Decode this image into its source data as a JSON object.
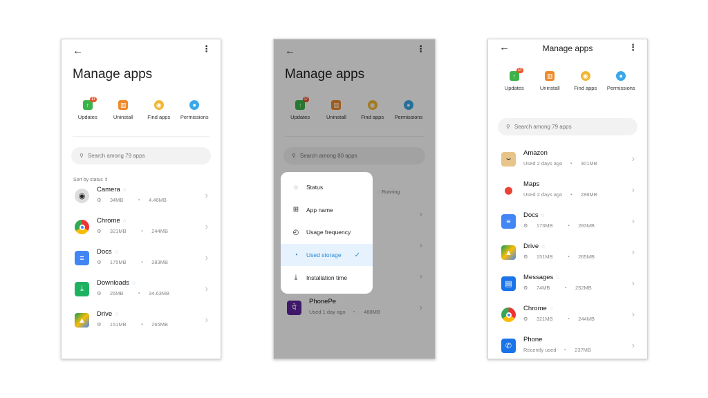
{
  "colors": {
    "accent": "#2a8ad8",
    "running": "#4a9ee0",
    "updates": "#3bb34a",
    "uninstall": "#ee8a2c",
    "find": "#f2b632",
    "permissions": "#3aa8e8"
  },
  "panels": [
    {
      "title": "Manage apps",
      "search_placeholder": "Search among 79 apps",
      "sort_label": "Sort by status ⇕",
      "tools": [
        {
          "label": "Updates",
          "icon": "updates-icon",
          "badge": "17"
        },
        {
          "label": "Uninstall",
          "icon": "trash-icon"
        },
        {
          "label": "Find apps",
          "icon": "find-apps-icon"
        },
        {
          "label": "Permissions",
          "icon": "permissions-icon"
        }
      ],
      "apps": [
        {
          "name": "Camera",
          "running": true,
          "m1": "34MB",
          "m2": "4.46MB",
          "icon": "camera-icon"
        },
        {
          "name": "Chrome",
          "running": true,
          "m1": "321MB",
          "m2": "244MB",
          "icon": "chrome-icon"
        },
        {
          "name": "Docs",
          "running": true,
          "m1": "175MB",
          "m2": "283MB",
          "icon": "docs-icon"
        },
        {
          "name": "Downloads",
          "running": true,
          "m1": "26MB",
          "m2": "34.63MB",
          "icon": "downloads-icon"
        },
        {
          "name": "Drive",
          "running": true,
          "m1": "151MB",
          "m2": "265MB",
          "icon": "drive-icon"
        }
      ]
    },
    {
      "title": "Manage apps",
      "search_placeholder": "Search among 80 apps",
      "running_label": "Running",
      "tools": [
        {
          "label": "Updates",
          "icon": "updates-icon",
          "badge": "17"
        },
        {
          "label": "Uninstall",
          "icon": "trash-icon"
        },
        {
          "label": "Find apps",
          "icon": "find-apps-icon"
        },
        {
          "label": "Permissions",
          "icon": "permissions-icon"
        }
      ],
      "apps": [
        {
          "name": "PhonePe",
          "running": false,
          "m1": "Used 1 day ago",
          "m2": "488MB",
          "icon": "phonepe-icon"
        }
      ],
      "sort_menu": [
        {
          "label": "Status",
          "icon": "status-icon"
        },
        {
          "label": "App name",
          "icon": "grid-icon"
        },
        {
          "label": "Usage frequency",
          "icon": "usage-icon"
        },
        {
          "label": "Used storage",
          "icon": "storage-icon",
          "selected": true
        },
        {
          "label": "Installation time",
          "icon": "install-time-icon"
        }
      ]
    },
    {
      "title": "Manage apps",
      "search_placeholder": "Search among 79 apps",
      "tools": [
        {
          "label": "Updates",
          "icon": "updates-icon",
          "badge": "17"
        },
        {
          "label": "Uninstall",
          "icon": "trash-icon"
        },
        {
          "label": "Find apps",
          "icon": "find-apps-icon"
        },
        {
          "label": "Permissions",
          "icon": "permissions-icon"
        }
      ],
      "apps": [
        {
          "name": "Amazon",
          "running": false,
          "m1": "Used 2 days ago",
          "m2": "301MB",
          "icon": "amazon-icon"
        },
        {
          "name": "Maps",
          "running": false,
          "m1": "Used 2 days ago",
          "m2": "286MB",
          "icon": "maps-icon"
        },
        {
          "name": "Docs",
          "running": true,
          "m1": "173MB",
          "m2": "283MB",
          "icon": "docs-icon"
        },
        {
          "name": "Drive",
          "running": true,
          "m1": "151MB",
          "m2": "265MB",
          "icon": "drive-icon"
        },
        {
          "name": "Messages",
          "running": true,
          "m1": "74MB",
          "m2": "252MB",
          "icon": "messages-icon"
        },
        {
          "name": "Chrome",
          "running": true,
          "m1": "321MB",
          "m2": "244MB",
          "icon": "chrome-icon"
        },
        {
          "name": "Phone",
          "running": false,
          "m1": "Recently used",
          "m2": "237MB",
          "icon": "phone-icon"
        }
      ]
    }
  ]
}
